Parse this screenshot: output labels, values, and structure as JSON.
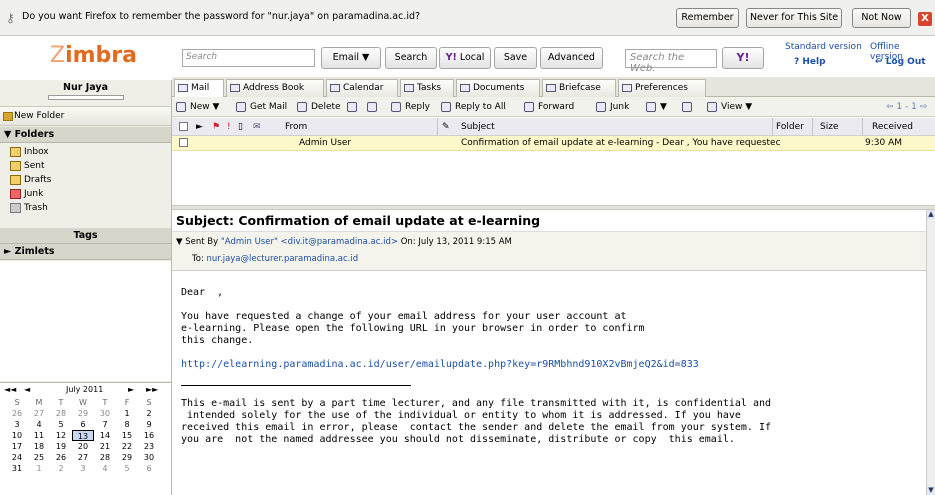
{
  "notification": {
    "message": "Do you want Firefox to remember the password for \"nur.jaya\" on paramadina.ac.id?",
    "remember": "Remember",
    "never": "Never for This Site",
    "not_now": "Not Now",
    "close": "X"
  },
  "brand": {
    "logo_prefix": "Z",
    "logo_rest": "imbra"
  },
  "search": {
    "placeholder": "Search",
    "email_label": "Email ▼",
    "search_label": "Search",
    "local_label": "Local",
    "save_label": "Save",
    "advanced_label": "Advanced",
    "web_placeholder": "Search the Web.",
    "yahoo_label": "Y!"
  },
  "topright": {
    "standard": "Standard version",
    "offline": "Offline version",
    "help": "Help",
    "logout": "Log Out"
  },
  "user": {
    "name": "Nur Jaya"
  },
  "sidebar": {
    "new_folder": "New Folder",
    "folders_title": "Folders",
    "folders": [
      "Inbox",
      "Sent",
      "Drafts",
      "Junk",
      "Trash"
    ],
    "tags_title": "Tags",
    "zimlets_title": "Zimlets"
  },
  "calendar": {
    "title": "July 2011",
    "dow": [
      "S",
      "M",
      "T",
      "W",
      "T",
      "F",
      "S"
    ],
    "weeks": [
      [
        "26",
        "27",
        "28",
        "29",
        "30",
        "1",
        "2"
      ],
      [
        "3",
        "4",
        "5",
        "6",
        "7",
        "8",
        "9"
      ],
      [
        "10",
        "11",
        "12",
        "13",
        "14",
        "15",
        "16"
      ],
      [
        "17",
        "18",
        "19",
        "20",
        "21",
        "22",
        "23"
      ],
      [
        "24",
        "25",
        "26",
        "27",
        "28",
        "29",
        "30"
      ],
      [
        "31",
        "1",
        "2",
        "3",
        "4",
        "5",
        "6"
      ]
    ]
  },
  "tabs": [
    "Mail",
    "Address Book",
    "Calendar",
    "Tasks",
    "Documents",
    "Briefcase",
    "Preferences"
  ],
  "toolbar": {
    "new": "New ▼",
    "get_mail": "Get Mail",
    "delete": "Delete",
    "reply": "Reply",
    "reply_all": "Reply to All",
    "forward": "Forward",
    "junk": "Junk",
    "view": "View ▼",
    "page": "1 - 1"
  },
  "list": {
    "from_header": "From",
    "subject_header": "Subject",
    "folder_header": "Folder",
    "size_header": "Size",
    "received_header": "Received",
    "row": {
      "from": "Admin User",
      "subject": "Confirmation of email update at e-learning - Dear , You have requestec",
      "received": "9:30 AM"
    }
  },
  "message": {
    "subject": "Subject: Confirmation of email update at e-learning",
    "sent_by_label": "Sent By",
    "sent_by": "\"Admin User\" <div.it@paramadina.ac.id>",
    "on_label": "On:",
    "date": "July 13, 2011 9:15 AM",
    "to_label": "To:",
    "to": "nur.jaya@lecturer.paramadina.ac.id",
    "greeting": "Dear  ,",
    "para1": "You have requested a change of your email address for your user account at\ne-learning. Please open the following URL in your browser in order to confirm\nthis change.",
    "url": "http://elearning.paramadina.ac.id/user/emailupdate.php?key=r9RMbhnd910X2vBmjeQ2&id=833",
    "disclaimer": "This e-mail is sent by a part time lecturer, and any file transmitted with it, is confidential and\n intended solely for the use of the individual or entity to whom it is addressed. If you have\nreceived this email in error, please  contact the sender and delete the email from your system. If\nyou are  not the named addressee you should not disseminate, distribute or copy  this email."
  }
}
